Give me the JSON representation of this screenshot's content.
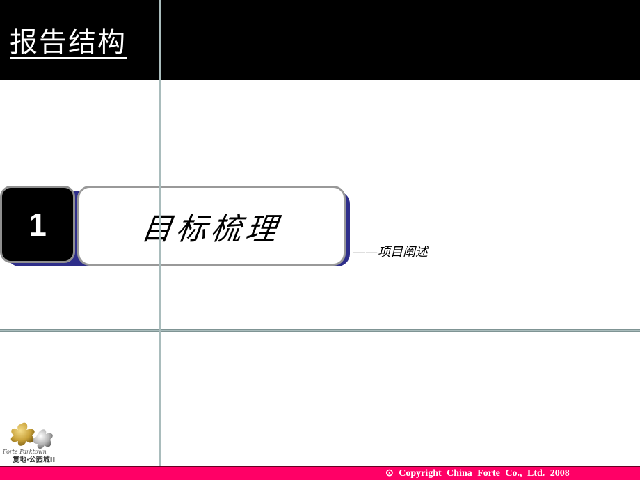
{
  "slide": {
    "title": "报告结构",
    "section_number": "1",
    "section_title": "目标梳理",
    "section_subtitle": "——项目阐述"
  },
  "logo": {
    "name_en": "Forte Parktown",
    "name_cn": "复地·公园城II"
  },
  "footer": {
    "copyright_symbol": "⊙",
    "copyright_text": "Copyright  China  Forte  Co., Ltd.  2008"
  },
  "colors": {
    "header_bg": "#000000",
    "footer_bg": "#ff0066",
    "shadow_accent": "#2e2e8a",
    "grid_line": "#a9bcbc"
  }
}
